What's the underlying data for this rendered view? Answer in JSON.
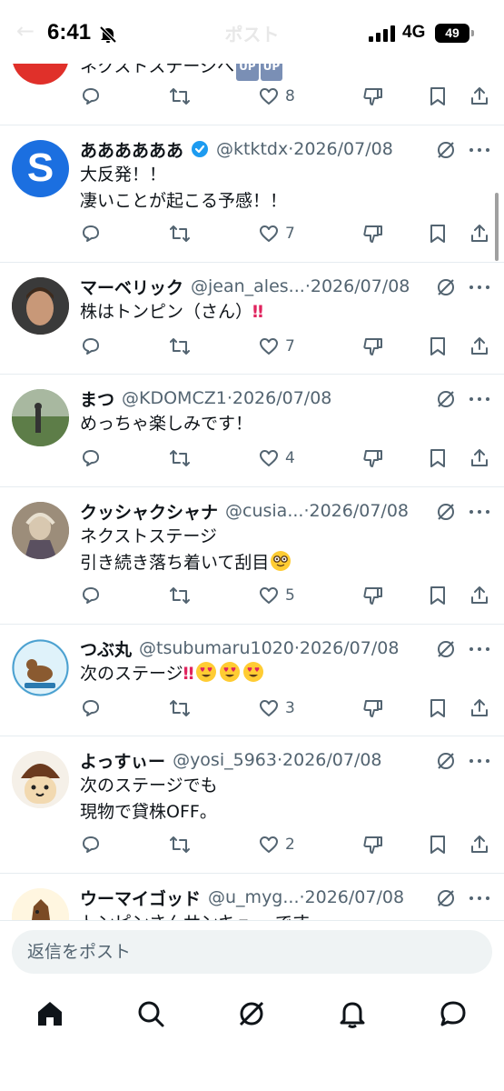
{
  "status_bar": {
    "time": "6:41",
    "network": "4G",
    "battery": "49",
    "background_title": "ポスト"
  },
  "posts": [
    {
      "body_lines": [
        "ネクストステージへ"
      ],
      "badges": [
        "UP",
        "UP"
      ],
      "replies": "",
      "retweets": "",
      "likes": "8"
    },
    {
      "name": "ああああああ",
      "verified": true,
      "handle": "@ktktdx",
      "sep": " · ",
      "date": "2026/07/08",
      "body_lines": [
        "大反発！！",
        "凄いことが起こる予感！！"
      ],
      "likes": "7"
    },
    {
      "name": "マーベリック",
      "handle": "@jean_ales...",
      "sep": " · ",
      "date": "2026/07/08",
      "body_lines": [
        "株はトンピン（さん）"
      ],
      "body_suffix": "‼",
      "likes": "7"
    },
    {
      "name": "まつ",
      "handle": "@KDOMCZ1",
      "sep": " · ",
      "date": "2026/07/08",
      "body_lines": [
        "めっちゃ楽しみです！"
      ],
      "likes": "4"
    },
    {
      "name": "クッシャクシャナ",
      "handle": "@cusia...",
      "sep": " · ",
      "date": "2026/07/08",
      "body_lines": [
        "ネクストステージ",
        "引き続き落ち着いて刮目"
      ],
      "emoji": "nerd-face",
      "likes": "5"
    },
    {
      "name": "つぶ丸",
      "handle": "@tsubumaru1020",
      "sep": " · ",
      "date": "2026/07/08",
      "body_lines": [
        "次のステージ"
      ],
      "body_suffix": "‼",
      "emoji": "heart-eyes x3",
      "likes": "3"
    },
    {
      "name": "よっすぃー",
      "handle": "@yosi_5963",
      "sep": " · ",
      "date": "2026/07/08",
      "body_lines": [
        "次のステージでも",
        "現物で貸株OFF。"
      ],
      "likes": "2"
    },
    {
      "name": "ウーマイゴッド",
      "handle": "@u_myg...",
      "sep": " · ",
      "date": "2026/07/08",
      "body_lines": [
        "トンピンさんサンキュー です"
      ]
    }
  ],
  "reply": {
    "placeholder": "返信をポスト"
  },
  "tabs": [
    "home-icon",
    "search-icon",
    "grok-icon",
    "notifications-icon",
    "messages-icon"
  ],
  "colors": {
    "text": "#0f1419",
    "muted": "#536471",
    "verified": "#1d9bf0",
    "divider": "#e6ecf0",
    "reply_bg": "#eff3f4"
  }
}
